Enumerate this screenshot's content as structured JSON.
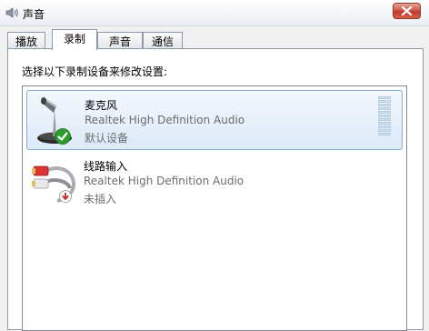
{
  "window": {
    "title": "声音"
  },
  "tabs": [
    {
      "label": "播放"
    },
    {
      "label": "录制"
    },
    {
      "label": "声音"
    },
    {
      "label": "通信"
    }
  ],
  "active_tab": "录制",
  "instruction": "选择以下录制设备来修改设置:",
  "devices": [
    {
      "name": "麦克风",
      "driver": "Realtek High Definition Audio",
      "status": "默认设备",
      "icon": "microphone-icon",
      "badge": "default-check-icon",
      "selected": true
    },
    {
      "name": "线路输入",
      "driver": "Realtek High Definition Audio",
      "status": "未插入",
      "icon": "line-in-cable-icon",
      "badge": "unplugged-arrow-icon",
      "selected": false
    }
  ],
  "colors": {
    "selection_border": "#84acdd",
    "close_button": "#c0392b",
    "check_badge": "#2e9b2e",
    "unplugged_badge": "#c62828"
  }
}
